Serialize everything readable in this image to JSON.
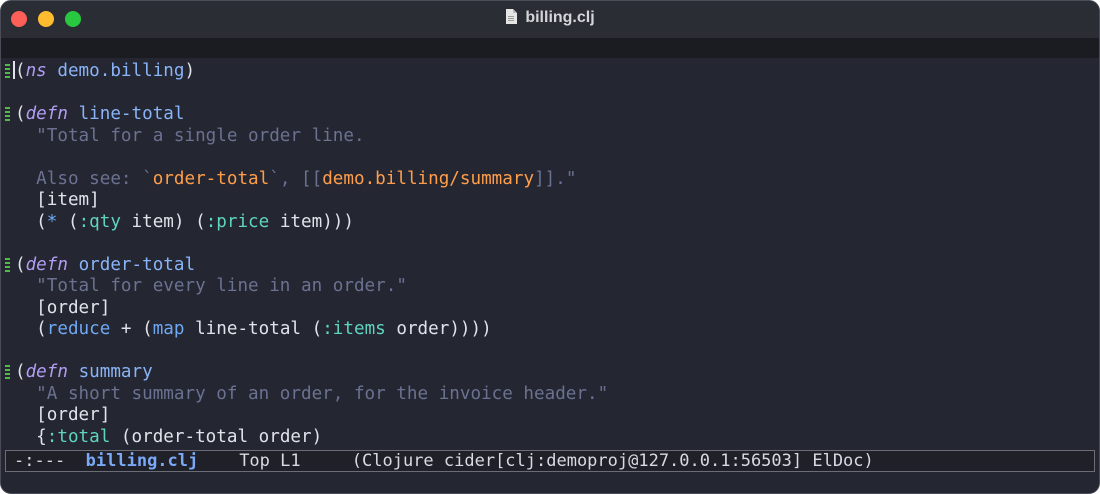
{
  "window": {
    "title": "billing.clj",
    "icon": "document-icon",
    "colors": {
      "background": "#242631",
      "titlebar": "#2b2d35",
      "close": "#fe5f57",
      "minimize": "#febc2e",
      "zoom": "#28c840"
    }
  },
  "code": {
    "l1": {
      "open": "(",
      "kw": "ns",
      "name": "demo.billing",
      "close": ")"
    },
    "l3": {
      "open": "(",
      "kw": "defn",
      "name": "line-total"
    },
    "l4": {
      "doc": "  \"Total for a single order line."
    },
    "l6": {
      "doc_a": "  Also see: `",
      "ref_a": "order-total",
      "doc_b": "`, [[",
      "ref_b": "demo.billing/summary",
      "doc_c": "]].\""
    },
    "l7": {
      "text": "  [item]"
    },
    "l8": {
      "a": "  (",
      "op": "*",
      "b": " (",
      "k1": ":qty",
      "c": " item) (",
      "k2": ":price",
      "d": " item)))"
    },
    "l10": {
      "open": "(",
      "kw": "defn",
      "name": "order-total"
    },
    "l11": {
      "doc": "  \"Total for every line in an order.\""
    },
    "l12": {
      "text": "  [order]"
    },
    "l13": {
      "a": "  (",
      "f1": "reduce",
      "b": " + (",
      "f2": "map",
      "c": " line-total (",
      "k": ":items",
      "d": " order))))"
    },
    "l15": {
      "open": "(",
      "kw": "defn",
      "name": "summary"
    },
    "l16": {
      "doc": "  \"A short summary of an order, for the invoice header.\""
    },
    "l17": {
      "text": "  [order]"
    },
    "l18": {
      "a": "  {",
      "k": ":total",
      "b": " (order-total order)"
    }
  },
  "modeline": {
    "status": "-:---  ",
    "buffer": "billing.clj",
    "position": "    Top L1     ",
    "modes": "(Clojure cider[clj:demoproj@127.0.0.1:56503] ElDoc)"
  }
}
